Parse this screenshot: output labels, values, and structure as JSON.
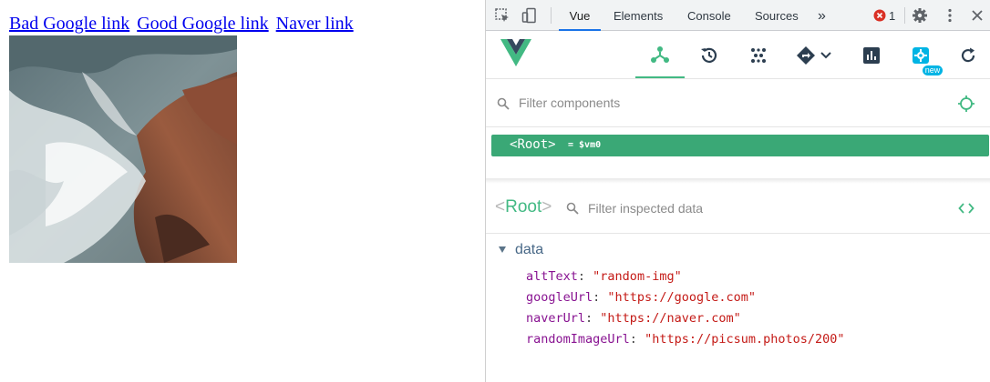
{
  "page": {
    "links": [
      "Bad Google link",
      "Good Google link",
      "Naver link"
    ]
  },
  "devtools": {
    "tabs": [
      "Vue",
      "Elements",
      "Console",
      "Sources"
    ],
    "more_tabs": "»",
    "error_count": "1",
    "vue_toolbar": {
      "new_badge": "new"
    },
    "components_filter_placeholder": "Filter components",
    "root_node": {
      "open": "<",
      "name": "Root",
      "close": ">",
      "vm": "= $vm0"
    },
    "inspector": {
      "title_open": "<",
      "title": "Root",
      "title_close": ">",
      "filter_placeholder": "Filter inspected data",
      "section": "data",
      "properties": [
        {
          "key": "altText",
          "value": "\"random-img\""
        },
        {
          "key": "googleUrl",
          "value": "\"https://google.com\""
        },
        {
          "key": "naverUrl",
          "value": "\"https://naver.com\""
        },
        {
          "key": "randomImageUrl",
          "value": "\"https://picsum.photos/200\""
        }
      ]
    },
    "colors": {
      "vue_green": "#42b983",
      "selected_row": "#3aa876",
      "active_tab_underline": "#1a73e8",
      "error_red": "#d93025"
    }
  }
}
